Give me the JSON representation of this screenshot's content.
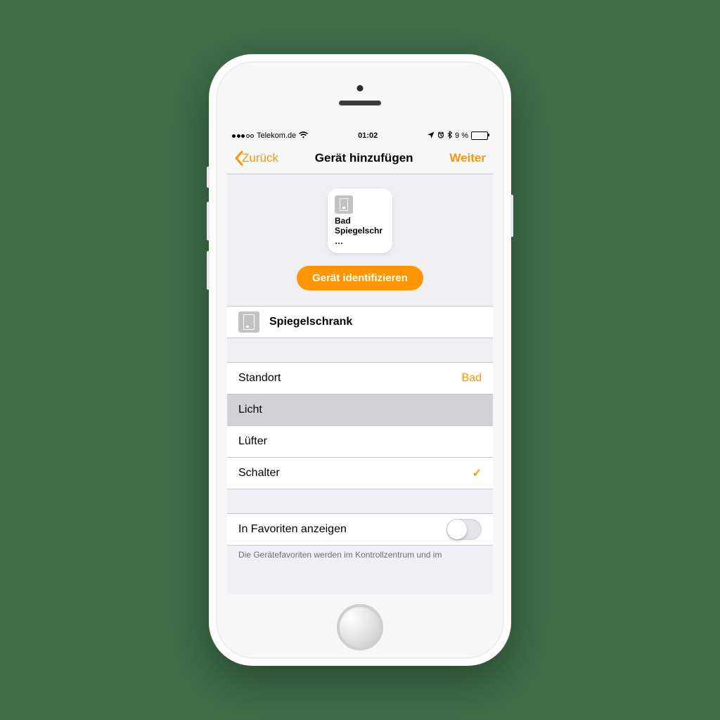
{
  "status": {
    "carrier": "Telekom.de",
    "time": "01:02",
    "battery_text": "9 %",
    "signal_filled": 3,
    "signal_total": 5
  },
  "nav": {
    "back": "Zurück",
    "title": "Gerät hinzufügen",
    "next": "Weiter"
  },
  "tile": {
    "line1": "Bad",
    "line2": "Spiegelschr…"
  },
  "identify_label": "Gerät identifizieren",
  "device_name": "Spiegelschrank",
  "location": {
    "label": "Standort",
    "value": "Bad"
  },
  "types": {
    "licht": "Licht",
    "luefter": "Lüfter",
    "schalter": "Schalter"
  },
  "favorites": {
    "label": "In Favoriten anzeigen"
  },
  "footnote": "Die Gerätefavoriten werden im Kontrollzentrum und im"
}
